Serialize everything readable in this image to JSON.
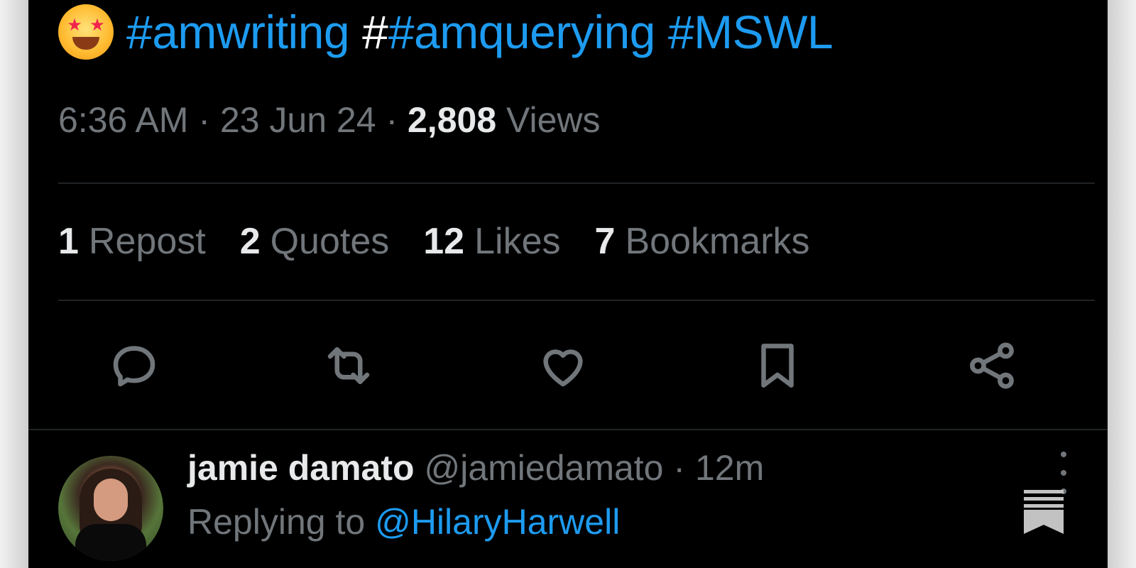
{
  "tweet": {
    "emoji": "star-struck-emoji",
    "hashtags": [
      "#amwriting",
      "#amquerying",
      "#MSWL"
    ],
    "extra_hash_prefix": "#",
    "time": "6:36 AM",
    "date": "23 Jun 24",
    "views_count": "2,808",
    "views_label": "Views",
    "stats": {
      "reposts_count": "1",
      "reposts_label": "Repost",
      "quotes_count": "2",
      "quotes_label": "Quotes",
      "likes_count": "12",
      "likes_label": "Likes",
      "bookmarks_count": "7",
      "bookmarks_label": "Bookmarks"
    },
    "actions": [
      "reply-icon",
      "repost-icon",
      "like-icon",
      "bookmark-icon",
      "share-icon"
    ]
  },
  "reply": {
    "name": "jamie damato",
    "handle": "@jamiedamato",
    "separator": "·",
    "time": "12m",
    "replying_prefix": "Replying to",
    "replying_to": "@HilaryHarwell"
  },
  "colors": {
    "background": "#000000",
    "link": "#1d9bf0",
    "muted": "#71767b",
    "text": "#e7e9ea"
  }
}
